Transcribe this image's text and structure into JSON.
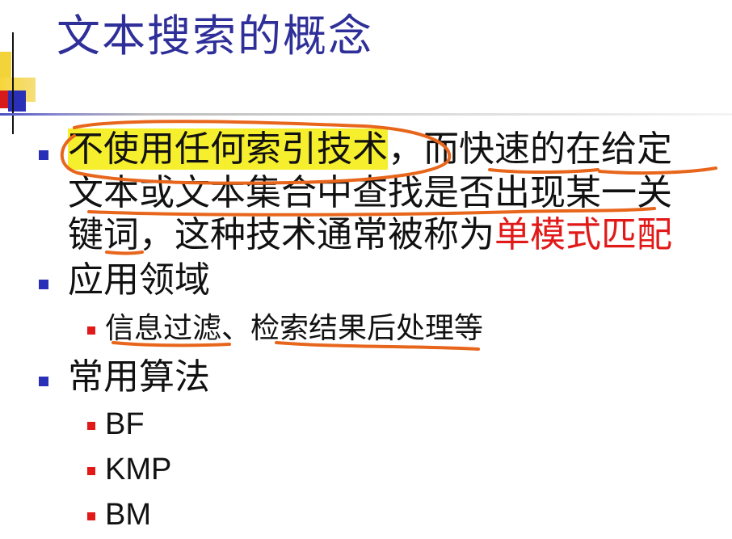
{
  "slide": {
    "title": "文本搜索的概念",
    "bullets": [
      {
        "highlighted_start": "不使用任何索引技术",
        "line1_rest": "，而快速的在给定",
        "line2": "文本或文本集合中查找是否出现某一关",
        "line3_start": "键词，这种技术通常被称为",
        "line3_red": "单模式匹配"
      },
      {
        "text": "应用领域"
      },
      {
        "text": "常用算法"
      }
    ],
    "sub_bullets_applications": [
      {
        "text": "信息过滤、检索结果后处理等"
      }
    ],
    "sub_bullets_algorithms": [
      {
        "text": "BF"
      },
      {
        "text": "KMP"
      },
      {
        "text": "BM"
      }
    ]
  },
  "colors": {
    "title": "#2f2f9a",
    "bullet_level1": "#2a2fb8",
    "bullet_level2": "#e11919",
    "highlight": "#f5ef2e",
    "emphasis_red": "#e11919",
    "ink_annotation": "#e8661c"
  }
}
